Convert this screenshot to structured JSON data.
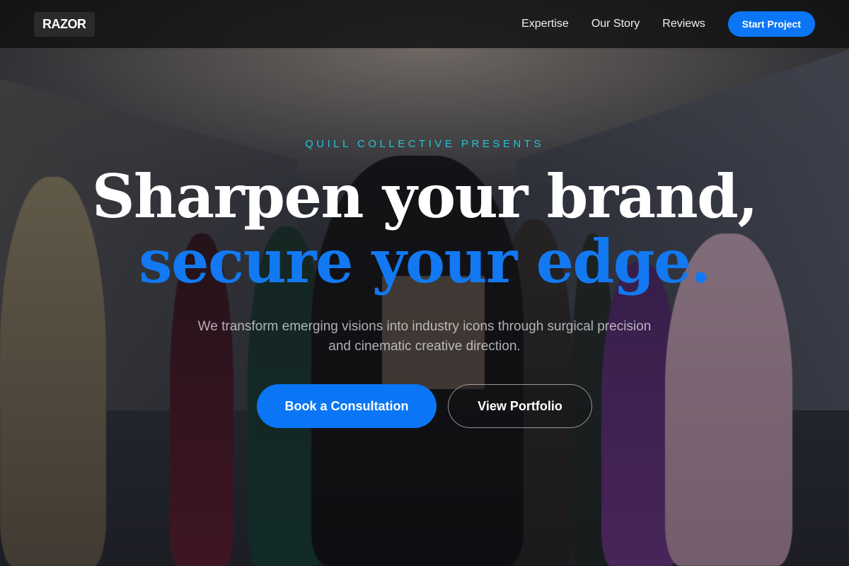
{
  "header": {
    "logo": "RAZOR",
    "nav": [
      {
        "label": "Expertise"
      },
      {
        "label": "Our Story"
      },
      {
        "label": "Reviews"
      }
    ],
    "cta_label": "Start Project"
  },
  "hero": {
    "eyebrow": "QUILL COLLECTIVE PRESENTS",
    "headline_line1": "Sharpen your brand,",
    "headline_line2": "secure your edge.",
    "subtitle": "We transform emerging visions into industry icons through surgical precision and cinematic creative direction.",
    "primary_cta": "Book a Consultation",
    "secondary_cta": "View Portfolio"
  },
  "colors": {
    "accent_blue": "#0a76f5",
    "eyebrow_cyan": "#20c6d8",
    "headline_blue": "#1279f2"
  }
}
